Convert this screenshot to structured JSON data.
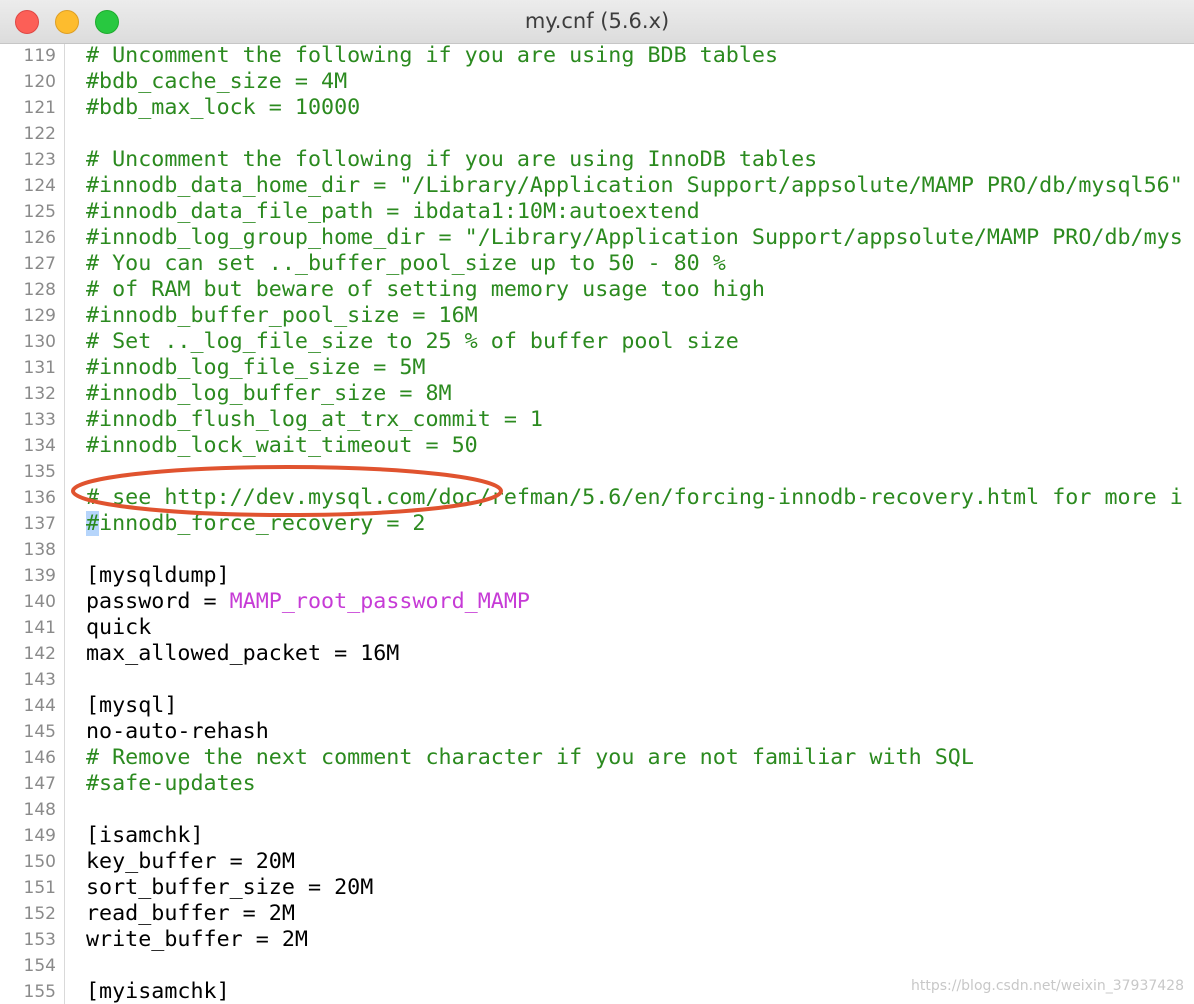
{
  "window": {
    "title": "my.cnf (5.6.x)"
  },
  "lines": [
    {
      "num": "119",
      "parts": [
        {
          "t": "# Uncomment the following if you are using BDB tables",
          "c": "comment"
        }
      ]
    },
    {
      "num": "120",
      "parts": [
        {
          "t": "#bdb_cache_size = 4M",
          "c": "comment"
        }
      ]
    },
    {
      "num": "121",
      "parts": [
        {
          "t": "#bdb_max_lock = 10000",
          "c": "comment"
        }
      ]
    },
    {
      "num": "122",
      "parts": []
    },
    {
      "num": "123",
      "parts": [
        {
          "t": "# Uncomment the following if you are using InnoDB tables",
          "c": "comment"
        }
      ]
    },
    {
      "num": "124",
      "parts": [
        {
          "t": "#innodb_data_home_dir = \"/Library/Application Support/appsolute/MAMP PRO/db/mysql56\"",
          "c": "comment"
        }
      ]
    },
    {
      "num": "125",
      "parts": [
        {
          "t": "#innodb_data_file_path = ibdata1:10M:autoextend",
          "c": "comment"
        }
      ]
    },
    {
      "num": "126",
      "parts": [
        {
          "t": "#innodb_log_group_home_dir = \"/Library/Application Support/appsolute/MAMP PRO/db/mys",
          "c": "comment"
        }
      ]
    },
    {
      "num": "127",
      "parts": [
        {
          "t": "# You can set .._buffer_pool_size up to 50 - 80 %",
          "c": "comment"
        }
      ]
    },
    {
      "num": "128",
      "parts": [
        {
          "t": "# of RAM but beware of setting memory usage too high",
          "c": "comment"
        }
      ]
    },
    {
      "num": "129",
      "parts": [
        {
          "t": "#innodb_buffer_pool_size = 16M",
          "c": "comment"
        }
      ]
    },
    {
      "num": "130",
      "parts": [
        {
          "t": "# Set .._log_file_size to 25 % of buffer pool size",
          "c": "comment"
        }
      ]
    },
    {
      "num": "131",
      "parts": [
        {
          "t": "#innodb_log_file_size = 5M",
          "c": "comment"
        }
      ]
    },
    {
      "num": "132",
      "parts": [
        {
          "t": "#innodb_log_buffer_size = 8M",
          "c": "comment"
        }
      ]
    },
    {
      "num": "133",
      "parts": [
        {
          "t": "#innodb_flush_log_at_trx_commit = 1",
          "c": "comment"
        }
      ]
    },
    {
      "num": "134",
      "parts": [
        {
          "t": "#innodb_lock_wait_timeout = 50",
          "c": "comment"
        }
      ]
    },
    {
      "num": "135",
      "parts": []
    },
    {
      "num": "136",
      "parts": [
        {
          "t": "# see http://dev.mysql.com/doc/refman/5.6/en/forcing-innodb-recovery.html for more i",
          "c": "comment"
        }
      ]
    },
    {
      "num": "137",
      "parts": [
        {
          "t": "#",
          "c": "comment sel"
        },
        {
          "t": "innodb_force_recovery = 2",
          "c": "comment"
        }
      ]
    },
    {
      "num": "138",
      "parts": []
    },
    {
      "num": "139",
      "parts": [
        {
          "t": "[mysqldump]",
          "c": "plain"
        }
      ]
    },
    {
      "num": "140",
      "parts": [
        {
          "t": "password = ",
          "c": "plain"
        },
        {
          "t": "MAMP_root_password_MAMP",
          "c": "value"
        }
      ]
    },
    {
      "num": "141",
      "parts": [
        {
          "t": "quick",
          "c": "plain"
        }
      ]
    },
    {
      "num": "142",
      "parts": [
        {
          "t": "max_allowed_packet = 16M",
          "c": "plain"
        }
      ]
    },
    {
      "num": "143",
      "parts": []
    },
    {
      "num": "144",
      "parts": [
        {
          "t": "[mysql]",
          "c": "plain"
        }
      ]
    },
    {
      "num": "145",
      "parts": [
        {
          "t": "no-auto-rehash",
          "c": "plain"
        }
      ]
    },
    {
      "num": "146",
      "parts": [
        {
          "t": "# Remove the next comment character if you are not familiar with SQL",
          "c": "comment"
        }
      ]
    },
    {
      "num": "147",
      "parts": [
        {
          "t": "#safe-updates",
          "c": "comment"
        }
      ]
    },
    {
      "num": "148",
      "parts": []
    },
    {
      "num": "149",
      "parts": [
        {
          "t": "[isamchk]",
          "c": "plain"
        }
      ]
    },
    {
      "num": "150",
      "parts": [
        {
          "t": "key_buffer = 20M",
          "c": "plain"
        }
      ]
    },
    {
      "num": "151",
      "parts": [
        {
          "t": "sort_buffer_size = 20M",
          "c": "plain"
        }
      ]
    },
    {
      "num": "152",
      "parts": [
        {
          "t": "read_buffer = 2M",
          "c": "plain"
        }
      ]
    },
    {
      "num": "153",
      "parts": [
        {
          "t": "write_buffer = 2M",
          "c": "plain"
        }
      ]
    },
    {
      "num": "154",
      "parts": []
    },
    {
      "num": "155",
      "parts": [
        {
          "t": "[myisamchk]",
          "c": "plain"
        }
      ]
    }
  ],
  "watermark": "https://blog.csdn.net/weixin_37937428",
  "colors": {
    "comment": "#2b8a1f",
    "value": "#c63bd6",
    "annotation_ring": "#e0532f"
  }
}
